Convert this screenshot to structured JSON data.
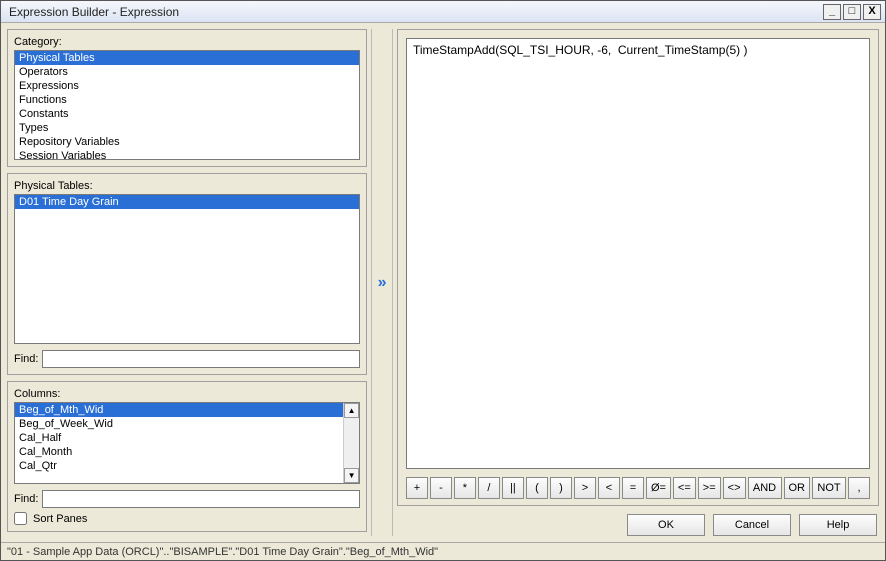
{
  "window": {
    "title": "Expression Builder - Expression"
  },
  "category": {
    "label": "Category:",
    "items": [
      "Physical Tables",
      "Operators",
      "Expressions",
      "Functions",
      "Constants",
      "Types",
      "Repository Variables",
      "Session Variables"
    ],
    "selected_index": 0
  },
  "physical_tables": {
    "label": "Physical Tables:",
    "items": [
      "D01 Time Day Grain"
    ],
    "selected_index": 0,
    "find_label": "Find:",
    "find_value": ""
  },
  "columns": {
    "label": "Columns:",
    "items": [
      "Beg_of_Mth_Wid",
      "Beg_of_Week_Wid",
      "Cal_Half",
      "Cal_Month",
      "Cal_Qtr"
    ],
    "selected_index": 0,
    "find_label": "Find:",
    "find_value": "",
    "sort_panes_label": "Sort Panes",
    "sort_panes_checked": false
  },
  "insert_button_tooltip": "Insert",
  "expression": {
    "value": "TimeStampAdd(SQL_TSI_HOUR, -6,  Current_TimeStamp(5) )"
  },
  "operators": [
    "+",
    "-",
    "*",
    "/",
    "||",
    "(",
    ")",
    ">",
    "<",
    "=",
    "Ø=",
    "<=",
    ">=",
    "<>",
    "AND",
    "OR",
    "NOT",
    ","
  ],
  "actions": {
    "ok": "OK",
    "cancel": "Cancel",
    "help": "Help"
  },
  "status_bar": "\"01 - Sample App Data (ORCL)\"..\"BISAMPLE\".\"D01 Time Day Grain\".\"Beg_of_Mth_Wid\"",
  "window_controls": {
    "minimize": "_",
    "maximize": "□",
    "close": "X"
  }
}
